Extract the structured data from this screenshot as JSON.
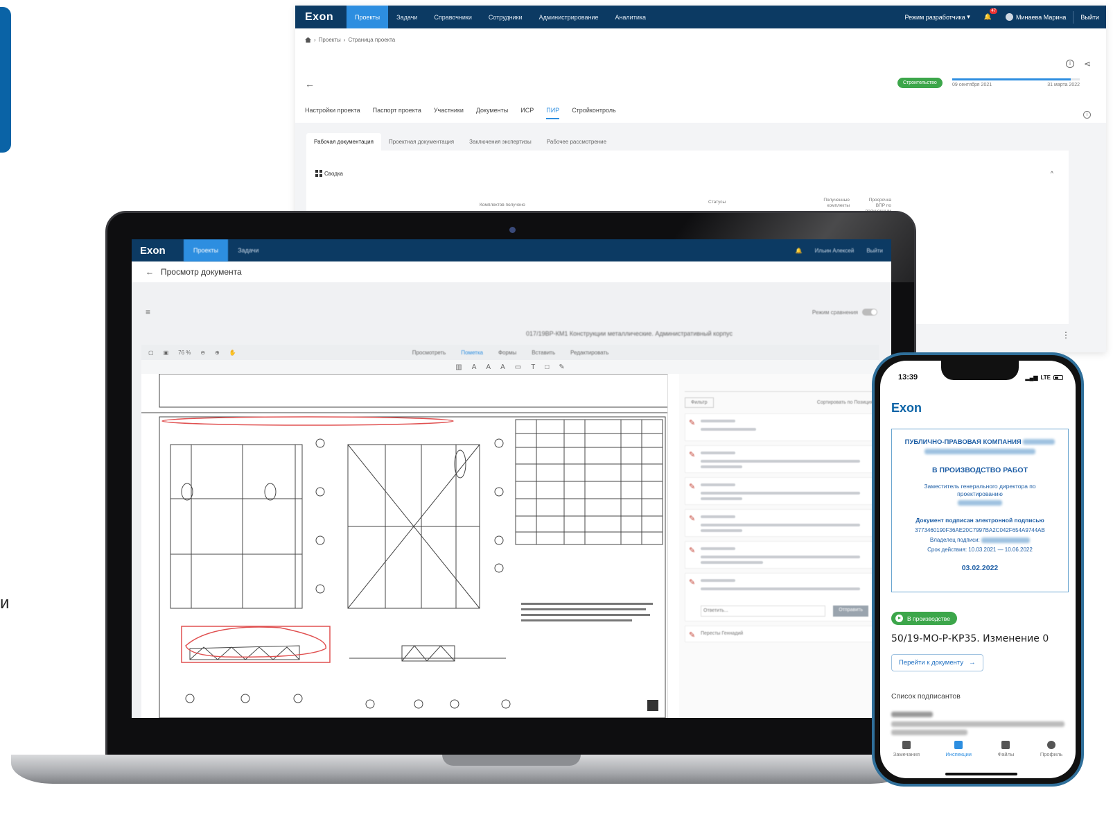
{
  "left_edge": {
    "letter": "и"
  },
  "browser": {
    "logo": "Exon",
    "nav": [
      "Проекты",
      "Задачи",
      "Справочники",
      "Сотрудники",
      "Администрирование",
      "Аналитика"
    ],
    "nav_active": 0,
    "dev_mode": "Режим разработчика",
    "notifications": "47",
    "user": "Минаева Марина",
    "logout": "Выйти",
    "breadcrumbs": [
      "Проекты",
      "Страница проекта"
    ],
    "stage": "Строительство",
    "date_start": "09 сентября 2021",
    "date_end": "31 марта 2022",
    "timeline_progress": 0.93,
    "tabs": [
      "Настройки проекта",
      "Паспорт проекта",
      "Участники",
      "Документы",
      "ИСР",
      "ПИР",
      "Стройконтроль"
    ],
    "tab_active": 5,
    "sub_tabs": [
      "Рабочая документация",
      "Проектная документация",
      "Заключения экспертизы",
      "Рабочее рассмотрение"
    ],
    "sub_tab_active": 0,
    "summary_title": "Сводка",
    "sets_received": "Комплектов получено",
    "statuses": "Статусы",
    "received_sets": "Полученные комплекты",
    "overdue": "Просрочка ВПР по полученным"
  },
  "laptop": {
    "logo": "Exon",
    "nav": [
      "Проекты",
      "Задачи"
    ],
    "user": "Ильин Алексей",
    "logout": "Выйти",
    "page_title": "Просмотр документа",
    "compare_mode": "Режим сравнения",
    "document_title": "017/19ВР-КМ1 Конструкции металлические. Административный корпус",
    "zoom": "76 %",
    "viewer_tabs": [
      "Просмотреть",
      "Пометка",
      "Формы",
      "Вставить",
      "Редактировать"
    ],
    "viewer_tab_active": 1,
    "filter": "Фильтр",
    "sort_label": "Сортировать по",
    "sort_value": "Позиция",
    "comment_placeholder": "Ответить...",
    "send": "Отправить",
    "last_author": "Пересты Геннадий"
  },
  "phone": {
    "time": "13:39",
    "network": "LTE",
    "logo": "Exon",
    "org": "ПУБЛИЧНО-ПРАВОВАЯ КОМПАНИЯ",
    "stamp_head": "В ПРОИЗВОДСТВО РАБОТ",
    "position": "Заместитель генерального директора по проектированию",
    "signed": "Документ подписан электронной подписью",
    "hash": "3773460190F36AE20C7997BA2C042F654A9744AB",
    "owner_label": "Владелец подписи:",
    "validity": "Срок действия: 10.03.2021 — 10.06.2022",
    "stamp_date": "03.02.2022",
    "status": "В производстве",
    "doc_code": "50/19-МО-Р-КР35. Изменение 0",
    "go_button": "Перейти к документу",
    "signers_title": "Список подписантов",
    "bottom_nav": [
      "Замечания",
      "Инспекции",
      "Файлы",
      "Профиль"
    ],
    "bottom_nav_active": 1
  }
}
